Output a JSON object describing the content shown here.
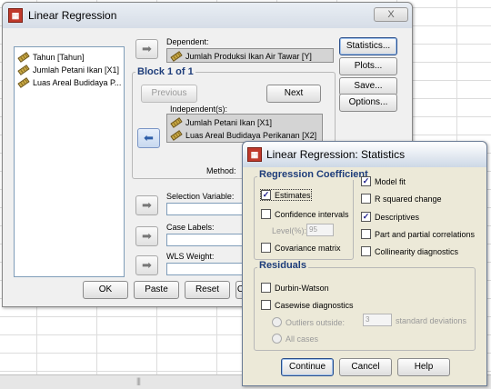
{
  "main_dialog": {
    "title": "Linear Regression",
    "close_glyph": "X",
    "variables": [
      "Tahun [Tahun]",
      "Jumlah Petani Ikan [X1]",
      "Luas Areal Budidaya P..."
    ],
    "dependent_label": "Dependent:",
    "dependent_value": "Jumlah Produksi Ikan Air Tawar [Y]",
    "block_label": "Block 1 of 1",
    "previous_label": "Previous",
    "next_label": "Next",
    "independents_label": "Independent(s):",
    "independents": [
      "Jumlah Petani Ikan [X1]",
      "Luas Areal Budidaya Perikanan [X2]"
    ],
    "method_label": "Method:",
    "selection_variable_label": "Selection Variable:",
    "case_labels_label": "Case Labels:",
    "wls_weight_label": "WLS Weight:",
    "side_buttons": [
      "Statistics...",
      "Plots...",
      "Save...",
      "Options..."
    ],
    "bottom_buttons": [
      "OK",
      "Paste",
      "Reset",
      "C"
    ]
  },
  "statistics_dialog": {
    "title": "Linear Regression: Statistics",
    "regression_coefficient_title": "Regression Coefficient",
    "estimates": {
      "label": "Estimates",
      "checked": true
    },
    "confidence_intervals": {
      "label": "Confidence intervals",
      "checked": false
    },
    "level_label": "Level(%):",
    "level_value": "95",
    "covariance_matrix": {
      "label": "Covariance matrix",
      "checked": false
    },
    "model_fit": {
      "label": "Model fit",
      "checked": true
    },
    "r_squared_change": {
      "label": "R squared change",
      "checked": false
    },
    "descriptives": {
      "label": "Descriptives",
      "checked": true
    },
    "part_partial": {
      "label": "Part and partial correlations",
      "checked": false
    },
    "collinearity": {
      "label": "Collinearity diagnostics",
      "checked": false
    },
    "residuals_title": "Residuals",
    "durbin_watson": {
      "label": "Durbin-Watson",
      "checked": false
    },
    "casewise": {
      "label": "Casewise diagnostics",
      "checked": false
    },
    "outliers_label": "Outliers outside:",
    "outliers_value": "3",
    "std_dev_label": "standard deviations",
    "all_cases_label": "All cases",
    "buttons": [
      "Continue",
      "Cancel",
      "Help"
    ]
  },
  "colors": {
    "group_title": "#1e3d7a",
    "dialog_bg": "#ece9d8",
    "check_mark": "#1a1a8a"
  },
  "icons": [
    "app-icon",
    "ruler-variable-icon",
    "right-arrow-icon",
    "left-arrow-icon",
    "checkmark-icon",
    "close-icon"
  ]
}
